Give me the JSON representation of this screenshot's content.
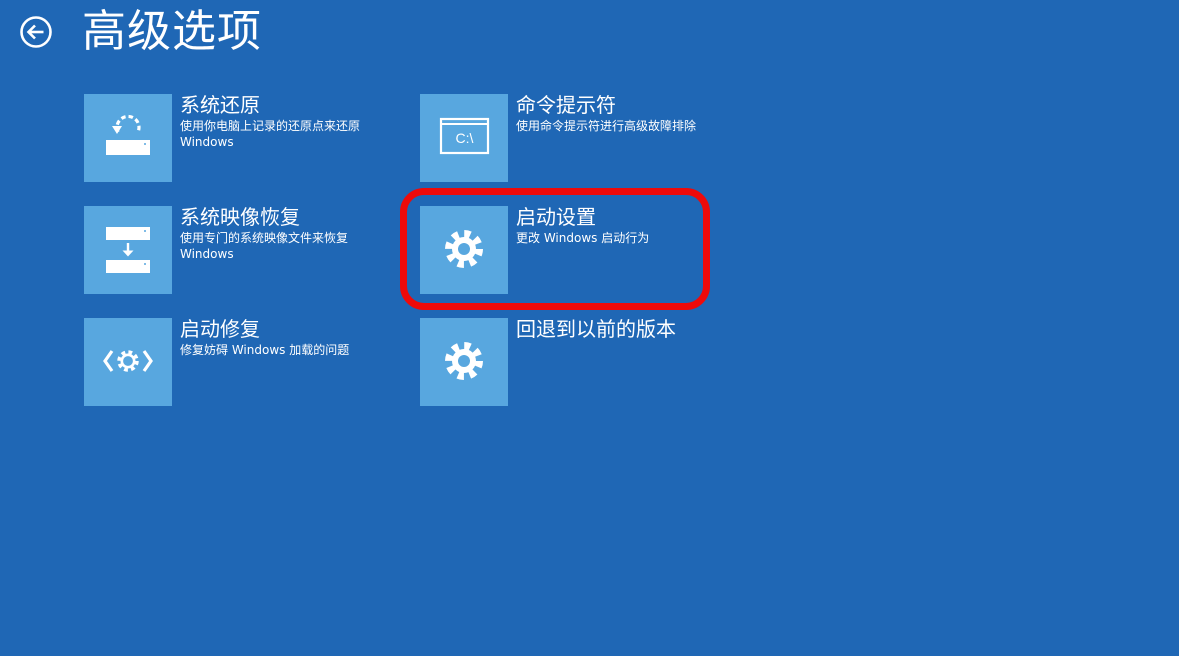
{
  "header": {
    "title": "高级选项",
    "back_icon": "back-arrow-circle-icon"
  },
  "colors": {
    "background": "#1f67b5",
    "tile": "#58a7df",
    "highlight": "#ee0a0a"
  },
  "options": [
    {
      "title": "系统还原",
      "description": "使用你电脑上记录的还原点来还原 Windows",
      "icon": "system-restore-icon"
    },
    {
      "title": "系统映像恢复",
      "description": "使用专门的系统映像文件来恢复 Windows",
      "icon": "system-image-recovery-icon"
    },
    {
      "title": "启动修复",
      "description": "修复妨碍 Windows 加载的问题",
      "icon": "startup-repair-icon"
    },
    {
      "title": "命令提示符",
      "description": "使用命令提示符进行高级故障排除",
      "icon": "command-prompt-icon",
      "icon_text": "C:\\"
    },
    {
      "title": "启动设置",
      "description": "更改 Windows 启动行为",
      "icon": "gear-icon"
    },
    {
      "title": "回退到以前的版本",
      "description": "",
      "icon": "gear-icon"
    }
  ]
}
